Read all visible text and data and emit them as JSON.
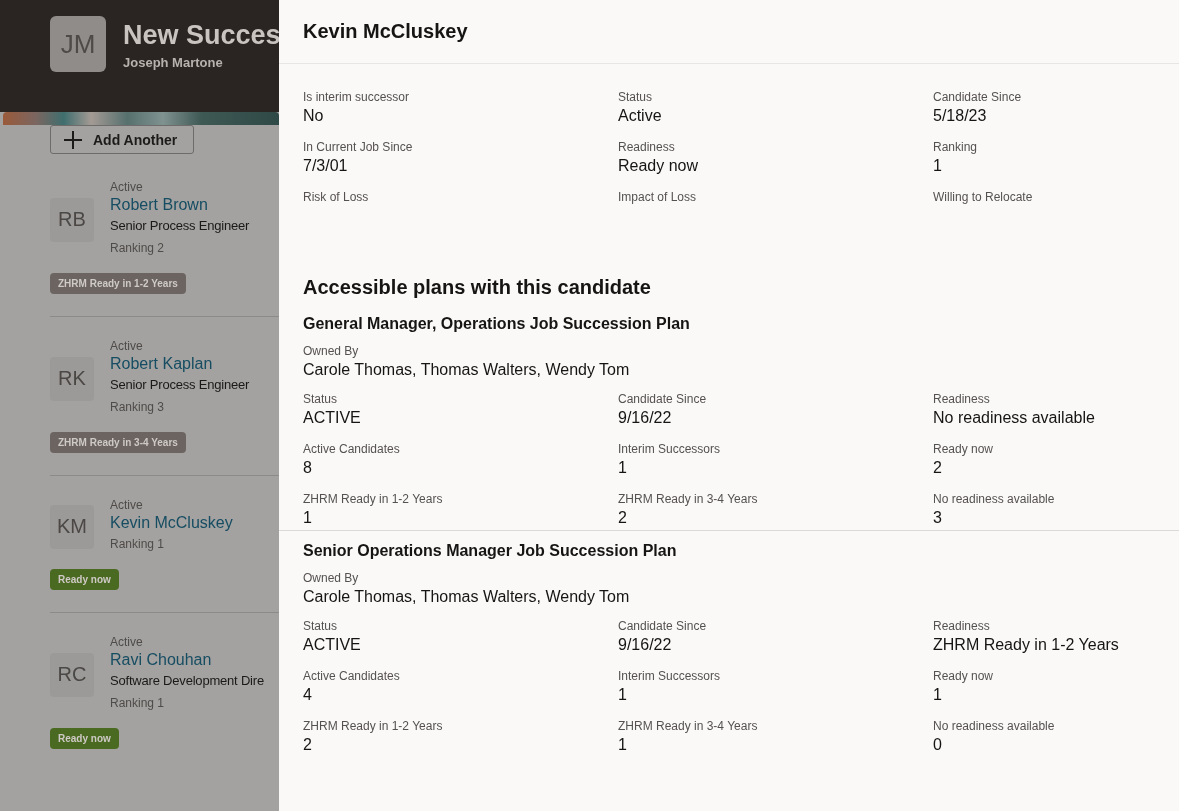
{
  "page": {
    "avatar_initials": "JM",
    "title": "New Succes",
    "subtitle": "Joseph Martone",
    "add_button": "Add Another"
  },
  "candidates": [
    {
      "initials": "RB",
      "status": "Active",
      "name": "Robert Brown",
      "job": "Senior Process Engineer",
      "ranking": "Ranking 2",
      "readiness": "ZHRM Ready in 1-2 Years",
      "color": "#6b6461"
    },
    {
      "initials": "RK",
      "status": "Active",
      "name": "Robert Kaplan",
      "job": "Senior Process Engineer",
      "ranking": "Ranking 3",
      "readiness": "ZHRM Ready in 3-4 Years",
      "color": "#6b6461"
    },
    {
      "initials": "KM",
      "status": "Active",
      "name": "Kevin McCluskey",
      "ranking": "Ranking 1",
      "readiness": "Ready now",
      "color": "#4a6a22"
    },
    {
      "initials": "RC",
      "status": "Active",
      "name": "Ravi Chouhan",
      "job": "Software Development Dire",
      "ranking": "Ranking 1",
      "readiness": "Ready now",
      "color": "#4a6a22"
    }
  ],
  "drawer": {
    "title": "Kevin McCluskey",
    "fields": [
      {
        "label": "Is interim successor",
        "value": "No"
      },
      {
        "label": "Status",
        "value": "Active"
      },
      {
        "label": "Candidate Since",
        "value": "5/18/23"
      },
      {
        "label": "In Current Job Since",
        "value": "7/3/01"
      },
      {
        "label": "Readiness",
        "value": "Ready now"
      },
      {
        "label": "Ranking",
        "value": "1"
      },
      {
        "label": "Risk of Loss"
      },
      {
        "label": "Impact of Loss"
      },
      {
        "label": "Willing to Relocate"
      }
    ],
    "plans_heading": "Accessible plans with this candidate",
    "plans": [
      {
        "title": "General Manager, Operations Job Succession Plan",
        "owned_by_label": "Owned By",
        "owned_by": "Carole Thomas, Thomas Walters, Wendy Tom",
        "fields": [
          {
            "label": "Status",
            "value": "ACTIVE"
          },
          {
            "label": "Candidate Since",
            "value": "9/16/22"
          },
          {
            "label": "Readiness",
            "value": "No readiness available"
          },
          {
            "label": "Active Candidates",
            "value": "8"
          },
          {
            "label": "Interim Successors",
            "value": "1"
          },
          {
            "label": "Ready now",
            "value": "2"
          },
          {
            "label": "ZHRM Ready in 1-2 Years",
            "value": "1"
          },
          {
            "label": "ZHRM Ready in 3-4 Years",
            "value": "2"
          },
          {
            "label": "No readiness available",
            "value": "3"
          }
        ]
      },
      {
        "title": "Senior Operations Manager Job Succession Plan",
        "owned_by_label": "Owned By",
        "owned_by": "Carole Thomas, Thomas Walters, Wendy Tom",
        "fields": [
          {
            "label": "Status",
            "value": "ACTIVE"
          },
          {
            "label": "Candidate Since",
            "value": "9/16/22"
          },
          {
            "label": "Readiness",
            "value": "ZHRM Ready in 1-2 Years"
          },
          {
            "label": "Active Candidates",
            "value": "4"
          },
          {
            "label": "Interim Successors",
            "value": "1"
          },
          {
            "label": "Ready now",
            "value": "1"
          },
          {
            "label": "ZHRM Ready in 1-2 Years",
            "value": "2"
          },
          {
            "label": "ZHRM Ready in 3-4 Years",
            "value": "1"
          },
          {
            "label": "No readiness available",
            "value": "0"
          }
        ]
      }
    ]
  }
}
